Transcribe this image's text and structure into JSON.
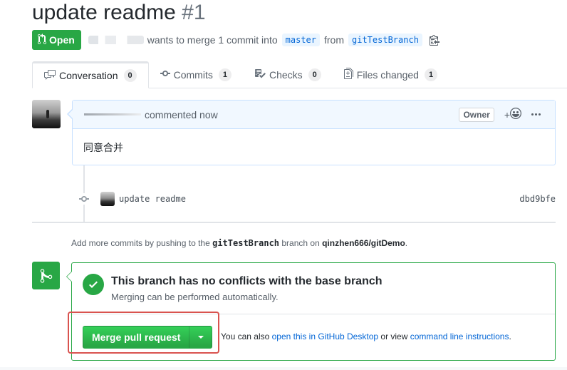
{
  "pr": {
    "title": "update readme",
    "number": "#1",
    "state": "Open",
    "author_suffix": "wants to merge 1 commit into",
    "base_branch": "master",
    "from_text": "from",
    "head_branch": "gitTestBranch"
  },
  "tabs": [
    {
      "label": "Conversation",
      "count": "0",
      "icon": "comment-discussion-icon"
    },
    {
      "label": "Commits",
      "count": "1",
      "icon": "git-commit-icon"
    },
    {
      "label": "Checks",
      "count": "0",
      "icon": "checklist-icon"
    },
    {
      "label": "Files changed",
      "count": "1",
      "icon": "file-diff-icon"
    }
  ],
  "comment": {
    "action": "commented now",
    "owner_label": "Owner",
    "reaction_plus": "+",
    "body": "同意合并"
  },
  "commit": {
    "message": "update readme",
    "sha": "dbd9bfe"
  },
  "push_hint": {
    "prefix": "Add more commits by pushing to the",
    "branch": "gitTestBranch",
    "middle": "branch on",
    "repo": "qinzhen666/gitDemo",
    "suffix": "."
  },
  "merge": {
    "status_title": "This branch has no conflicts with the base branch",
    "status_sub": "Merging can be performed automatically.",
    "button_label": "Merge pull request",
    "alt_prefix": "You can also",
    "alt_link1": "open this in GitHub Desktop",
    "alt_middle": "or view",
    "alt_link2": "command line instructions",
    "alt_suffix": "."
  },
  "colors": {
    "success": "#28a745",
    "link": "#0366d6",
    "highlight": "#d9534f"
  }
}
